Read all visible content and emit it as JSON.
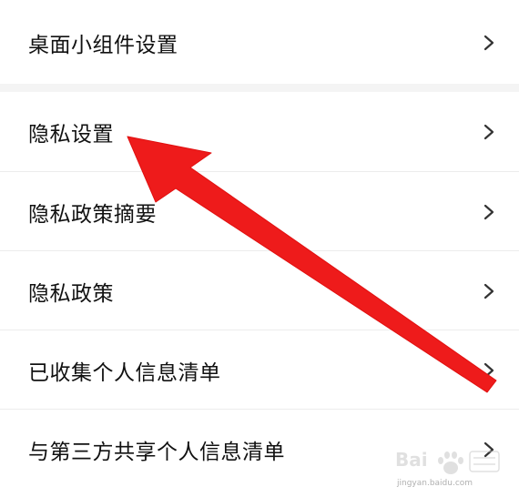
{
  "settings": {
    "widget_row": {
      "label": "桌面小组件设置",
      "icon": "chevron-right-icon"
    },
    "rows": [
      {
        "label": "隐私设置",
        "icon": "chevron-right-icon"
      },
      {
        "label": "隐私政策摘要",
        "icon": "chevron-right-icon"
      },
      {
        "label": "隐私政策",
        "icon": "chevron-right-icon"
      },
      {
        "label": "已收集个人信息清单",
        "icon": "chevron-right-icon"
      },
      {
        "label": "与第三方共享个人信息清单",
        "icon": "chevron-right-icon"
      }
    ]
  },
  "annotation": {
    "icon": "red-arrow-icon",
    "color": "#ee1b1b"
  },
  "watermark": {
    "icon": "baidu-paw-logo-icon",
    "text": "jingyan.baidu.com"
  },
  "colors": {
    "background": "#f4f4f4",
    "row_background": "#ffffff",
    "text": "#111111",
    "chevron": "#333333",
    "divider": "#ececec"
  }
}
